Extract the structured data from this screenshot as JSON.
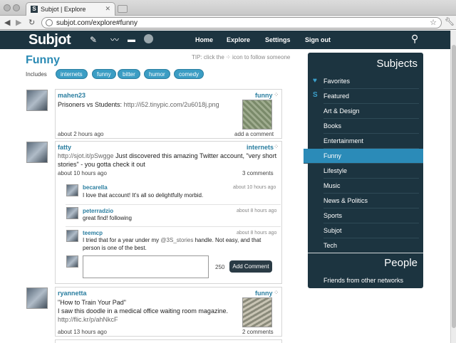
{
  "browser": {
    "tab_title": "Subjot | Explore",
    "tab_favicon": "S",
    "url": "subjot.com/explore#funny"
  },
  "header": {
    "logo": "Subjot",
    "nav": [
      "Home",
      "Explore",
      "Settings",
      "Sign out"
    ]
  },
  "main": {
    "title": "Funny",
    "tip": "TIP: click the",
    "tip_end": "icon to follow someone",
    "includes_label": "Includes",
    "includes": [
      "internets",
      "funny",
      "bitter",
      "humor",
      "comedy"
    ]
  },
  "posts": [
    {
      "user": "mahen23",
      "subject": "funny",
      "text": "Prisoners vs Students:",
      "link": "http://i52.tinypic.com/2u6018j.png",
      "time": "about 2 hours ago",
      "action": "add a comment"
    },
    {
      "user": "fatty",
      "subject": "internets",
      "link": "http://sjot.it/pSwgge",
      "text": "Just discovered this amazing Twitter account, \"very short stories\" - you gotta check it out",
      "time": "about 10 hours ago",
      "action": "3 comments",
      "comments": [
        {
          "user": "becarella",
          "time": "about 10 hours ago",
          "text": "I love that account! It's all so delightfully morbid."
        },
        {
          "user": "peterradzio",
          "time": "about 8 hours ago",
          "text": "great find! following"
        },
        {
          "user": "teemcp",
          "time": "about 8 hours ago",
          "text_1": "I tried that for a year under my",
          "handle": "@3S_stories",
          "text_2": "handle. Not easy, and that person is one of the best."
        }
      ],
      "char_count": "250",
      "add_comment": "Add Comment"
    },
    {
      "user": "ryannetta",
      "subject": "funny",
      "line1": "\"How to Train Your Pad\"",
      "line2": "I saw this doodle in a medical office waiting room magazine.",
      "link": "http://flic.kr/p/ahNkcF",
      "time": "about 13 hours ago",
      "action": "2 comments"
    }
  ],
  "sidebar": {
    "subjects_heading": "Subjects",
    "items": [
      "Favorites",
      "Featured",
      "Art & Design",
      "Books",
      "Entertainment",
      "Funny",
      "Lifestyle",
      "Music",
      "News & Politics",
      "Sports",
      "Subjot",
      "Tech"
    ],
    "active": "Funny",
    "people_heading": "People",
    "people_items": [
      "Friends from other networks"
    ]
  },
  "colors": {
    "header_bg": "#1c3440",
    "accent": "#2a8ab4",
    "chip_bg": "#3b9dc4",
    "active_item": "#2b8bb8"
  },
  "icons": [
    "compose-icon",
    "activity-icon",
    "chat-icon",
    "globe-icon",
    "search-icon",
    "follow-grid-icon",
    "heart-icon",
    "s-icon"
  ]
}
